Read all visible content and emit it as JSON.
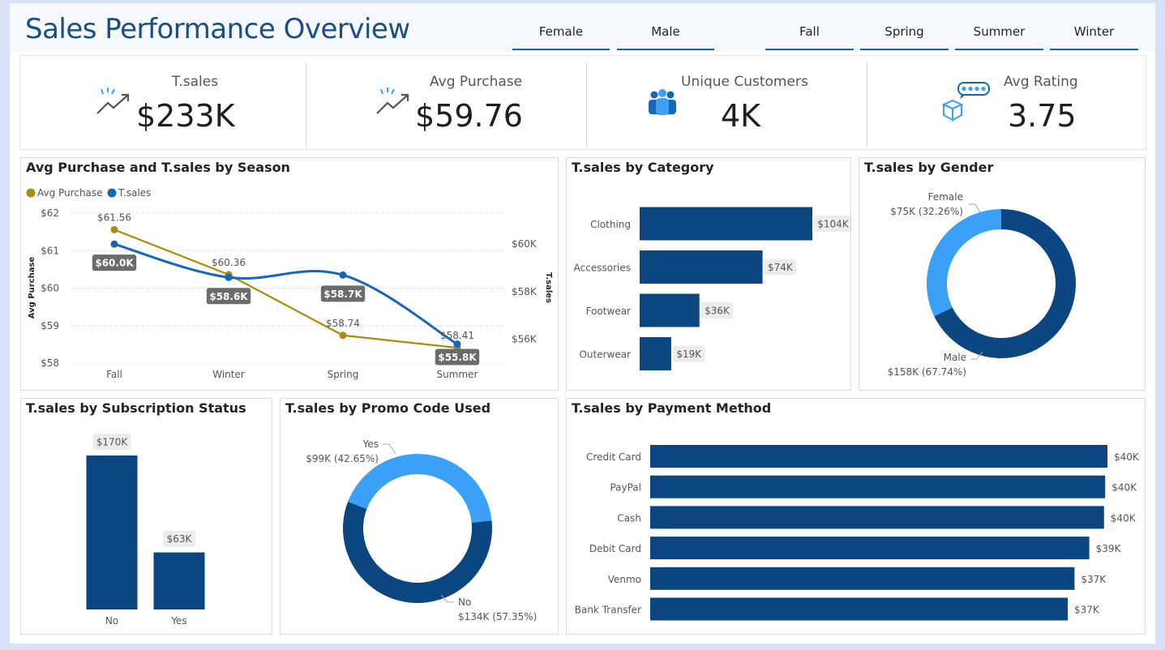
{
  "header": {
    "title": "Sales Performance Overview",
    "gender_slicer": [
      "Female",
      "Male"
    ],
    "season_slicer": [
      "Fall",
      "Spring",
      "Summer",
      "Winter"
    ]
  },
  "kpis": [
    {
      "label": "T.sales",
      "value": "$233K",
      "icon": "trend-up-icon"
    },
    {
      "label": "Avg Purchase",
      "value": "$59.76",
      "icon": "trend-up-icon"
    },
    {
      "label": "Unique Customers",
      "value": "4K",
      "icon": "people-icon"
    },
    {
      "label": "Avg Rating",
      "value": "3.75",
      "icon": "rating-box-icon"
    }
  ],
  "colors": {
    "dark_blue": "#0b4680",
    "light_blue": "#3aa0f8",
    "series_gold": "#a88c0a",
    "series_blue": "#1767b9",
    "label_gray": "#6b6b6b"
  },
  "chart_data": [
    {
      "id": "season",
      "type": "line",
      "title": "Avg Purchase and T.sales by Season",
      "categories": [
        "Fall",
        "Winter",
        "Spring",
        "Summer"
      ],
      "series": [
        {
          "name": "Avg Purchase",
          "axis": "left",
          "values": [
            61.56,
            60.36,
            58.74,
            58.41
          ],
          "labels": [
            "$61.56",
            "$60.36",
            "$58.74",
            "$58.41"
          ]
        },
        {
          "name": "T.sales",
          "axis": "right",
          "values": [
            60.0,
            58.6,
            58.7,
            55.8
          ],
          "labels": [
            "$60.0K",
            "$58.6K",
            "$58.7K",
            "$55.8K"
          ]
        }
      ],
      "ylabel": "Avg Purchase",
      "y2label": "T.sales",
      "ylim": [
        58,
        62
      ],
      "yticks": [
        "$58",
        "$59",
        "$60",
        "$61",
        "$62"
      ],
      "y2lim": [
        55,
        61.3
      ],
      "y2ticks": [
        {
          "v": 56,
          "label": "$56K"
        },
        {
          "v": 58,
          "label": "$58K"
        },
        {
          "v": 60,
          "label": "$60K"
        }
      ],
      "legend": "top-left",
      "grid": true
    },
    {
      "id": "category",
      "type": "bar",
      "orientation": "horizontal",
      "title": "T.sales by Category",
      "categories": [
        "Clothing",
        "Accessories",
        "Footwear",
        "Outerwear"
      ],
      "values": [
        104,
        74,
        36,
        19
      ],
      "labels": [
        "$104K",
        "$74K",
        "$36K",
        "$19K"
      ],
      "xlim": [
        0,
        104
      ]
    },
    {
      "id": "gender",
      "type": "pie",
      "title": "T.sales by Gender",
      "slices": [
        {
          "name": "Female",
          "value": 75,
          "percent": 32.26,
          "label": "$75K (32.26%)"
        },
        {
          "name": "Male",
          "value": 158,
          "percent": 67.74,
          "label": "$158K (67.74%)"
        }
      ]
    },
    {
      "id": "subscription",
      "type": "bar",
      "orientation": "vertical",
      "title": "T.sales by Subscription Status",
      "categories": [
        "No",
        "Yes"
      ],
      "values": [
        170,
        63
      ],
      "labels": [
        "$170K",
        "$63K"
      ],
      "ylim": [
        0,
        170
      ]
    },
    {
      "id": "promo",
      "type": "pie",
      "title": "T.sales by Promo Code Used",
      "slices": [
        {
          "name": "Yes",
          "value": 99,
          "percent": 42.65,
          "label": "$99K (42.65%)"
        },
        {
          "name": "No",
          "value": 134,
          "percent": 57.35,
          "label": "$134K (57.35%)"
        }
      ]
    },
    {
      "id": "payment",
      "type": "bar",
      "orientation": "horizontal",
      "title": "T.sales by Payment Method",
      "categories": [
        "Credit Card",
        "PayPal",
        "Cash",
        "Debit Card",
        "Venmo",
        "Bank Transfer"
      ],
      "values": [
        40.3,
        40.1,
        40.0,
        38.7,
        37.4,
        36.8
      ],
      "labels": [
        "$40K",
        "$40K",
        "$40K",
        "$39K",
        "$37K",
        "$37K"
      ],
      "xlim": [
        0,
        40.3
      ]
    }
  ]
}
